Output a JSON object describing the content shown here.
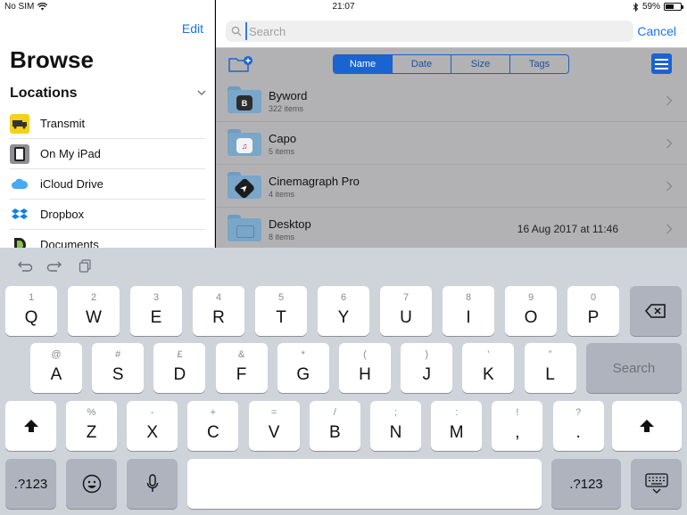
{
  "status": {
    "carrier": "No SIM",
    "time": "21:07",
    "battery": "59%",
    "battery_fraction": 0.59
  },
  "sidebar": {
    "edit": "Edit",
    "title": "Browse",
    "locations_heading": "Locations",
    "locations": [
      {
        "label": "Transmit",
        "icon": "transmit-icon"
      },
      {
        "label": "On My iPad",
        "icon": "ipad-icon"
      },
      {
        "label": "iCloud Drive",
        "icon": "icloud-icon"
      },
      {
        "label": "Dropbox",
        "icon": "dropbox-icon"
      },
      {
        "label": "Documents",
        "icon": "documents-icon"
      }
    ]
  },
  "main": {
    "search_placeholder": "Search",
    "cancel": "Cancel",
    "sort_tabs": [
      "Name",
      "Date",
      "Size",
      "Tags"
    ],
    "active_sort": "Name",
    "files": [
      {
        "name": "Byword",
        "count": "322 items",
        "date": "",
        "glyph": "B"
      },
      {
        "name": "Capo",
        "count": "5 items",
        "date": "",
        "glyph": "♫"
      },
      {
        "name": "Cinemagraph Pro",
        "count": "4 items",
        "date": "",
        "glyph": "➤"
      },
      {
        "name": "Desktop",
        "count": "8 items",
        "date": "16 Aug 2017 at 11:46",
        "glyph": ""
      }
    ]
  },
  "keyboard": {
    "row1": [
      [
        "1",
        "Q"
      ],
      [
        "2",
        "W"
      ],
      [
        "3",
        "E"
      ],
      [
        "4",
        "R"
      ],
      [
        "5",
        "T"
      ],
      [
        "6",
        "Y"
      ],
      [
        "7",
        "U"
      ],
      [
        "8",
        "I"
      ],
      [
        "9",
        "O"
      ],
      [
        "0",
        "P"
      ]
    ],
    "row2": [
      [
        "@",
        "A"
      ],
      [
        "#",
        "S"
      ],
      [
        "£",
        "D"
      ],
      [
        "&",
        "F"
      ],
      [
        "*",
        "G"
      ],
      [
        "(",
        "H"
      ],
      [
        ")",
        "J"
      ],
      [
        "’",
        "K"
      ],
      [
        "”",
        "L"
      ]
    ],
    "row3": [
      [
        "%",
        "Z"
      ],
      [
        "-",
        "X"
      ],
      [
        "+",
        "C"
      ],
      [
        "=",
        "V"
      ],
      [
        "/",
        "B"
      ],
      [
        ";",
        "N"
      ],
      [
        ":",
        "M"
      ],
      [
        "!",
        ","
      ],
      [
        "?",
        "."
      ]
    ],
    "search_key": "Search",
    "numbers_key": ".?123",
    "colors": {
      "accent": "#1a73e8",
      "keyboard_bg": "#cfd3da"
    }
  }
}
